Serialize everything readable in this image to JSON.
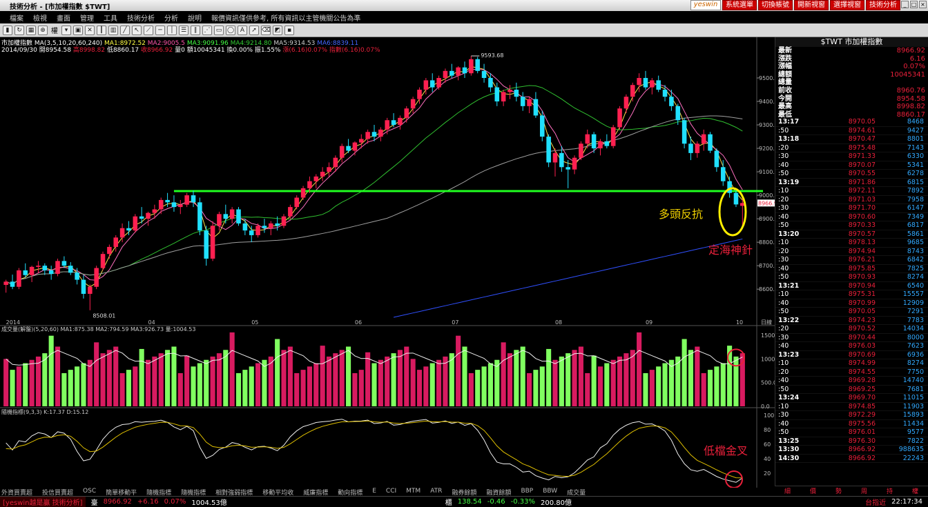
{
  "window": {
    "title": "技術分析 - [市加權指數 $TWT]"
  },
  "app_buttons": {
    "logo": "yeswin",
    "btn1": "系統選單",
    "btn2": "切換帳號",
    "btn3": "開新視窗",
    "btn4": "選擇視窗",
    "btn5": "技術分析"
  },
  "menu": [
    "檔案",
    "檢視",
    "畫面",
    "管理",
    "工具",
    "技術分析",
    "分析",
    "說明",
    "報價資訊僅供參考, 所有資訊以主管機關公告為準"
  ],
  "toolbar": {
    "period_label": "權"
  },
  "info": {
    "line1": {
      "name": "市加權指數",
      "ma": "MA(3,5,10,20,60,240)",
      "ma1": "MA1:8972.52",
      "ma2": "MA2:9005.5",
      "ma3": "MA3:9091.96",
      "ma4": "MA4:9214.80",
      "ma5": "MA5:9314.53",
      "ma6": "MA6:8839.11"
    },
    "line2": {
      "date": "2014/09/30",
      "open": "開8954.58",
      "high": "高8998.82",
      "low": "低8860.17",
      "close": "收8966.92",
      "vol": "量0",
      "amount": "額10045341",
      "chg": "換0.00%",
      "amp": "振1.55%",
      "rise": "漲(6.16)0.07%",
      "idx": "指數(6.16)0.07%"
    }
  },
  "price_panel": {
    "high_label": "9593.68",
    "low_label": "8508.01",
    "current_tag": "8966.9",
    "y_ticks": [
      "9500.0",
      "9400.0",
      "9300.0",
      "9200.0",
      "9100.0",
      "9000.0",
      "8900.0",
      "8800.0",
      "8700.0",
      "8600.0"
    ],
    "x_labels": [
      "2014",
      "04",
      "05",
      "06",
      "07",
      "08",
      "09",
      "10"
    ],
    "period": "日線"
  },
  "volume_panel": {
    "title": "成交量(解盤)(5,20,60)",
    "ma1": "MA1:875.38",
    "ma2": "MA2:794.59",
    "ma3": "MA3:926.73",
    "vol": "量:1004.53",
    "y_ticks": [
      "1500.0",
      "1000.0",
      "500.0",
      "0.0"
    ]
  },
  "kd_panel": {
    "title": "隨機指標(9,3,3)",
    "k": "K:17.37",
    "d": "D:15.12",
    "y_ticks": [
      "100",
      "80",
      "60",
      "40",
      "20"
    ]
  },
  "annotations": {
    "bull": "多頭反抗",
    "pin": "定海神針",
    "cross": "低檔金叉"
  },
  "quote": {
    "title": "$TWT 市加權指數",
    "rows": [
      {
        "l": "最新",
        "v": "8966.92"
      },
      {
        "l": "漲跌",
        "v": "6.16"
      },
      {
        "l": "漲幅",
        "v": "0.07%"
      },
      {
        "l": "總額",
        "v": "10045341"
      },
      {
        "l": "總量",
        "v": ""
      },
      {
        "l": "前收",
        "v": "8960.76"
      },
      {
        "l": "今開",
        "v": "8954.58"
      },
      {
        "l": "最高",
        "v": "8998.82"
      },
      {
        "l": "最低",
        "v": "8860.17"
      }
    ]
  },
  "ticks": [
    {
      "t": "13:17",
      "p": "8970.05",
      "v": "8468"
    },
    {
      "t": ":50",
      "p": "8974.61",
      "v": "9427"
    },
    {
      "t": "13:18",
      "p": "8970.47",
      "v": "8801"
    },
    {
      "t": ":20",
      "p": "8975.48",
      "v": "7143"
    },
    {
      "t": ":30",
      "p": "8971.33",
      "v": "6330"
    },
    {
      "t": ":40",
      "p": "8970.07",
      "v": "5341"
    },
    {
      "t": ":50",
      "p": "8970.55",
      "v": "6278"
    },
    {
      "t": "13:19",
      "p": "8971.86",
      "v": "6815"
    },
    {
      "t": ":10",
      "p": "8972.11",
      "v": "7892"
    },
    {
      "t": ":20",
      "p": "8971.03",
      "v": "7958"
    },
    {
      "t": ":30",
      "p": "8971.70",
      "v": "6147"
    },
    {
      "t": ":40",
      "p": "8970.60",
      "v": "7349"
    },
    {
      "t": ":50",
      "p": "8970.33",
      "v": "6817"
    },
    {
      "t": "13:20",
      "p": "8970.57",
      "v": "5861"
    },
    {
      "t": ":10",
      "p": "8978.13",
      "v": "9685"
    },
    {
      "t": ":20",
      "p": "8974.94",
      "v": "8743"
    },
    {
      "t": ":30",
      "p": "8976.21",
      "v": "6842"
    },
    {
      "t": ":40",
      "p": "8975.85",
      "v": "7825"
    },
    {
      "t": ":50",
      "p": "8970.93",
      "v": "8274"
    },
    {
      "t": "13:21",
      "p": "8970.94",
      "v": "6540"
    },
    {
      "t": ":10",
      "p": "8975.31",
      "v": "15557"
    },
    {
      "t": ":40",
      "p": "8970.99",
      "v": "12909"
    },
    {
      "t": ":50",
      "p": "8970.05",
      "v": "7291"
    },
    {
      "t": "13:22",
      "p": "8974.23",
      "v": "7783"
    },
    {
      "t": ":20",
      "p": "8970.52",
      "v": "14034"
    },
    {
      "t": ":30",
      "p": "8970.44",
      "v": "8000"
    },
    {
      "t": ":40",
      "p": "8976.03",
      "v": "7623"
    },
    {
      "t": "13:23",
      "p": "8970.69",
      "v": "6936"
    },
    {
      "t": ":10",
      "p": "8974.99",
      "v": "8274"
    },
    {
      "t": ":20",
      "p": "8974.55",
      "v": "7750"
    },
    {
      "t": ":40",
      "p": "8969.28",
      "v": "14740"
    },
    {
      "t": ":50",
      "p": "8969.25",
      "v": "7681"
    },
    {
      "t": "13:24",
      "p": "8969.70",
      "v": "11015"
    },
    {
      "t": ":10",
      "p": "8974.85",
      "v": "11903"
    },
    {
      "t": ":30",
      "p": "8972.29",
      "v": "15893"
    },
    {
      "t": ":40",
      "p": "8975.56",
      "v": "11434"
    },
    {
      "t": ":50",
      "p": "8976.01",
      "v": "9577"
    },
    {
      "t": "13:25",
      "p": "8976.30",
      "v": "7822"
    },
    {
      "t": "13:30",
      "p": "8966.92",
      "v": "988635"
    },
    {
      "t": "14:30",
      "p": "8966.92",
      "v": "22243"
    }
  ],
  "right_tabs": [
    "細",
    "價",
    "勢",
    "周",
    "持",
    "權"
  ],
  "bottom_tabs": [
    "外資買賣超",
    "投信買賣超",
    "OSC",
    "簡單移動平",
    "隨機指標",
    "隨機指標",
    "相對強弱指標",
    "移動平均收",
    "威廉指標",
    "動向指標",
    "E",
    "CCI",
    "MTM",
    "ATR",
    "融券餘額",
    "融資餘額",
    "BBP",
    "BBW",
    "成交量"
  ],
  "status": {
    "app": "[yeswin越是贏 技術分析]",
    "idx_label": "臺",
    "idx_val": "8966.92",
    "idx_chg": "+6.16",
    "idx_pct": "0.07%",
    "idx_vol": "1004.53億",
    "otc_label": "櫃",
    "otc_val": "138.54",
    "otc_chg": "-0.46",
    "otc_pct": "-0.33%",
    "otc_vol": "200.80億",
    "right1": "台指近",
    "clock": "22:17:34"
  },
  "chart_data": {
    "type": "candlestick",
    "resistance_level": 9018,
    "price_range": [
      8480,
      9650
    ],
    "candles": [
      [
        8618,
        8640,
        8585,
        8632
      ],
      [
        8632,
        8662,
        8600,
        8610
      ],
      [
        8610,
        8690,
        8600,
        8680
      ],
      [
        8680,
        8710,
        8650,
        8660
      ],
      [
        8660,
        8700,
        8630,
        8695
      ],
      [
        8695,
        8720,
        8670,
        8700
      ],
      [
        8700,
        8710,
        8660,
        8680
      ],
      [
        8680,
        8700,
        8640,
        8665
      ],
      [
        8665,
        8730,
        8655,
        8720
      ],
      [
        8720,
        8740,
        8690,
        8700
      ],
      [
        8700,
        8715,
        8660,
        8670
      ],
      [
        8670,
        8690,
        8620,
        8640
      ],
      [
        8640,
        8660,
        8560,
        8580
      ],
      [
        8580,
        8620,
        8510,
        8610
      ],
      [
        8610,
        8700,
        8600,
        8690
      ],
      [
        8690,
        8760,
        8680,
        8750
      ],
      [
        8750,
        8790,
        8730,
        8780
      ],
      [
        8780,
        8830,
        8760,
        8820
      ],
      [
        8820,
        8880,
        8800,
        8860
      ],
      [
        8860,
        8890,
        8830,
        8850
      ],
      [
        8850,
        8920,
        8840,
        8910
      ],
      [
        8910,
        8950,
        8880,
        8900
      ],
      [
        8900,
        8930,
        8870,
        8925
      ],
      [
        8925,
        8960,
        8900,
        8940
      ],
      [
        8940,
        8990,
        8920,
        8980
      ],
      [
        8980,
        9010,
        8950,
        8970
      ],
      [
        8970,
        9000,
        8930,
        8950
      ],
      [
        8950,
        8980,
        8920,
        8960
      ],
      [
        8960,
        9010,
        8950,
        9000
      ],
      [
        9000,
        9020,
        8950,
        8970
      ],
      [
        8970,
        8990,
        8830,
        8850
      ],
      [
        8850,
        8870,
        8700,
        8730
      ],
      [
        8730,
        8890,
        8720,
        8870
      ],
      [
        8870,
        8930,
        8850,
        8920
      ],
      [
        8920,
        8960,
        8880,
        8900
      ],
      [
        8900,
        8950,
        8880,
        8940
      ],
      [
        8940,
        8950,
        8870,
        8880
      ],
      [
        8880,
        8900,
        8830,
        8850
      ],
      [
        8850,
        8870,
        8800,
        8830
      ],
      [
        8830,
        8880,
        8820,
        8870
      ],
      [
        8870,
        8900,
        8840,
        8860
      ],
      [
        8860,
        8890,
        8830,
        8880
      ],
      [
        8880,
        8910,
        8850,
        8870
      ],
      [
        8870,
        8920,
        8860,
        8910
      ],
      [
        8910,
        8960,
        8900,
        8950
      ],
      [
        8950,
        9000,
        8940,
        8990
      ],
      [
        8990,
        9040,
        8980,
        9030
      ],
      [
        9030,
        9080,
        9010,
        9060
      ],
      [
        9060,
        9090,
        9030,
        9080
      ],
      [
        9080,
        9120,
        9060,
        9100
      ],
      [
        9100,
        9140,
        9080,
        9120
      ],
      [
        9120,
        9170,
        9100,
        9160
      ],
      [
        9160,
        9220,
        9140,
        9210
      ],
      [
        9210,
        9240,
        9180,
        9190
      ],
      [
        9190,
        9230,
        9170,
        9225
      ],
      [
        9225,
        9260,
        9200,
        9240
      ],
      [
        9240,
        9280,
        9220,
        9270
      ],
      [
        9270,
        9300,
        9230,
        9250
      ],
      [
        9250,
        9290,
        9230,
        9280
      ],
      [
        9280,
        9330,
        9260,
        9320
      ],
      [
        9320,
        9350,
        9290,
        9300
      ],
      [
        9300,
        9340,
        9280,
        9330
      ],
      [
        9330,
        9380,
        9310,
        9370
      ],
      [
        9370,
        9420,
        9350,
        9410
      ],
      [
        9410,
        9460,
        9390,
        9450
      ],
      [
        9450,
        9500,
        9430,
        9490
      ],
      [
        9490,
        9520,
        9440,
        9460
      ],
      [
        9460,
        9510,
        9450,
        9500
      ],
      [
        9500,
        9540,
        9480,
        9530
      ],
      [
        9530,
        9560,
        9500,
        9510
      ],
      [
        9510,
        9550,
        9490,
        9545
      ],
      [
        9545,
        9570,
        9500,
        9520
      ],
      [
        9520,
        9594,
        9510,
        9580
      ],
      [
        9580,
        9590,
        9520,
        9530
      ],
      [
        9530,
        9560,
        9480,
        9500
      ],
      [
        9500,
        9520,
        9440,
        9460
      ],
      [
        9460,
        9480,
        9380,
        9400
      ],
      [
        9400,
        9450,
        9380,
        9440
      ],
      [
        9440,
        9470,
        9410,
        9450
      ],
      [
        9450,
        9480,
        9400,
        9420
      ],
      [
        9420,
        9440,
        9360,
        9380
      ],
      [
        9380,
        9420,
        9350,
        9410
      ],
      [
        9410,
        9440,
        9330,
        9340
      ],
      [
        9340,
        9360,
        9230,
        9250
      ],
      [
        9250,
        9260,
        9120,
        9140
      ],
      [
        9140,
        9200,
        9080,
        9180
      ],
      [
        9180,
        9210,
        9100,
        9120
      ],
      [
        9120,
        9150,
        9030,
        9110
      ],
      [
        9110,
        9170,
        9090,
        9160
      ],
      [
        9160,
        9230,
        9150,
        9220
      ],
      [
        9220,
        9280,
        9200,
        9260
      ],
      [
        9260,
        9270,
        9180,
        9200
      ],
      [
        9200,
        9240,
        9170,
        9230
      ],
      [
        9230,
        9260,
        9200,
        9210
      ],
      [
        9210,
        9300,
        9200,
        9290
      ],
      [
        9290,
        9380,
        9280,
        9370
      ],
      [
        9370,
        9430,
        9350,
        9420
      ],
      [
        9420,
        9480,
        9400,
        9470
      ],
      [
        9470,
        9520,
        9440,
        9500
      ],
      [
        9500,
        9530,
        9450,
        9460
      ],
      [
        9460,
        9500,
        9430,
        9490
      ],
      [
        9490,
        9510,
        9440,
        9450
      ],
      [
        9450,
        9470,
        9400,
        9420
      ],
      [
        9420,
        9450,
        9360,
        9380
      ],
      [
        9380,
        9390,
        9300,
        9320
      ],
      [
        9320,
        9330,
        9200,
        9220
      ],
      [
        9220,
        9250,
        9150,
        9180
      ],
      [
        9180,
        9230,
        9160,
        9220
      ],
      [
        9220,
        9280,
        9190,
        9260
      ],
      [
        9260,
        9270,
        9180,
        9190
      ],
      [
        9190,
        9200,
        9100,
        9120
      ],
      [
        9120,
        9150,
        9040,
        9060
      ],
      [
        9060,
        9080,
        8990,
        9010
      ],
      [
        9010,
        9020,
        8950,
        8961
      ],
      [
        8955,
        8999,
        8860,
        8967
      ]
    ]
  }
}
